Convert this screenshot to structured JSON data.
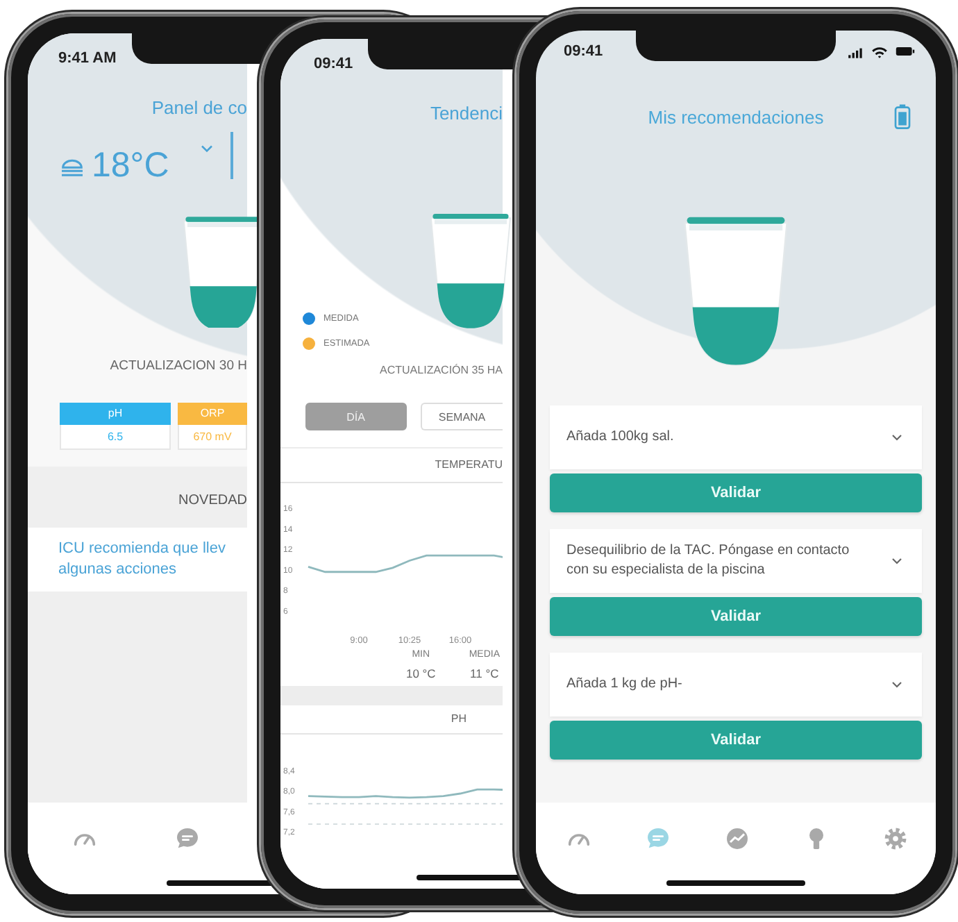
{
  "phones": [
    {
      "kind": "dashboard",
      "time": "9:41 AM",
      "title": "Panel de co",
      "temperature": "18°C",
      "update": "ACTUALIZACION 30 H",
      "tiles": [
        {
          "label": "pH",
          "value": "6.5",
          "color": "#2fb3ec"
        },
        {
          "label": "ORP",
          "value": "670 mV",
          "color": "#f9b942"
        }
      ],
      "news": {
        "heading": "NOVEDAD",
        "lines": [
          "ICU recomienda que llev",
          "algunas acciones"
        ]
      },
      "nav": [
        {
          "kind": "gauge",
          "selected": false
        },
        {
          "kind": "chat",
          "selected": false
        }
      ]
    },
    {
      "kind": "trends",
      "time": "09:41",
      "title": "Tendenci",
      "legend": [
        {
          "label": "MEDIDA",
          "color": "#1f88d8"
        },
        {
          "label": "ESTIMADA",
          "color": "#f6b13d"
        }
      ],
      "update": "ACTUALIZACIÓN 35 HA",
      "tabs": [
        {
          "label": "DÍA",
          "selected": true
        },
        {
          "label": "SEMANA",
          "selected": false
        }
      ],
      "charts": [
        {
          "heading": "TEMPERATU",
          "chart_data": {
            "type": "line",
            "categories": [
              null,
              null,
              null,
              "9:00",
              null,
              null,
              "10:25",
              null,
              null,
              "16:00",
              null,
              null,
              null
            ],
            "ylim": [
              6,
              16
            ],
            "yticks": [
              16,
              14,
              12,
              10,
              8,
              6
            ],
            "series": [
              {
                "color": "#8fb9bd",
                "values": [
                  10.3,
                  9.8,
                  9.8,
                  9.8,
                  9.8,
                  10.2,
                  10.9,
                  11.4,
                  11.4,
                  11.4,
                  11.4,
                  11.4,
                  11.1
                ]
              }
            ]
          },
          "stats": [
            {
              "label": "MIN",
              "value": "10 °C"
            },
            {
              "label": "MEDIA",
              "value": "11 °C"
            }
          ]
        },
        {
          "heading": "PH",
          "chart_data": {
            "type": "line",
            "categories": [
              null,
              null,
              null,
              null,
              null,
              null,
              null,
              null,
              null,
              null,
              null,
              null,
              null
            ],
            "ylim": [
              7.2,
              8.4
            ],
            "yticks": [
              {
                "value": 8.4,
                "label": "8,4"
              },
              {
                "value": 8.0,
                "label": "8,0"
              },
              {
                "value": 7.6,
                "label": "7,6"
              },
              {
                "value": 7.2,
                "label": "7,2"
              }
            ],
            "series": [
              {
                "color": "#8fb9bd",
                "values": [
                  7.9,
                  7.89,
                  7.88,
                  7.88,
                  7.9,
                  7.88,
                  7.87,
                  7.88,
                  7.9,
                  7.95,
                  8.03,
                  8.03,
                  8.02
                ]
              },
              {
                "color": "#c9d4d8",
                "line_style": "dashed",
                "values": [
                  7.75,
                  7.75,
                  7.75,
                  7.75,
                  7.75,
                  7.75,
                  7.75,
                  7.75,
                  7.75,
                  7.75,
                  7.75,
                  7.75,
                  7.75
                ]
              },
              {
                "color": "#c9d4d8",
                "line_style": "dashed",
                "values": [
                  7.35,
                  7.35,
                  7.35,
                  7.35,
                  7.35,
                  7.35,
                  7.35,
                  7.35,
                  7.35,
                  7.35,
                  7.35,
                  7.35,
                  7.35
                ]
              }
            ]
          }
        }
      ]
    },
    {
      "kind": "recommendations",
      "time": "09:41",
      "title": "Mis recomendaciones",
      "recommendations": [
        {
          "text": "Añada 100kg sal.",
          "button": "Validar"
        },
        {
          "text": "Desequilibrio de la TAC. Póngase en contacto con su especialista de la piscina",
          "button": "Validar"
        },
        {
          "text": "Añada 1 kg de pH-",
          "button": "Validar"
        }
      ],
      "nav": [
        {
          "kind": "gauge",
          "selected": false
        },
        {
          "kind": "chat",
          "selected": true
        },
        {
          "kind": "trend",
          "selected": false
        },
        {
          "kind": "bulb",
          "selected": false
        },
        {
          "kind": "gear",
          "selected": false
        }
      ]
    }
  ]
}
